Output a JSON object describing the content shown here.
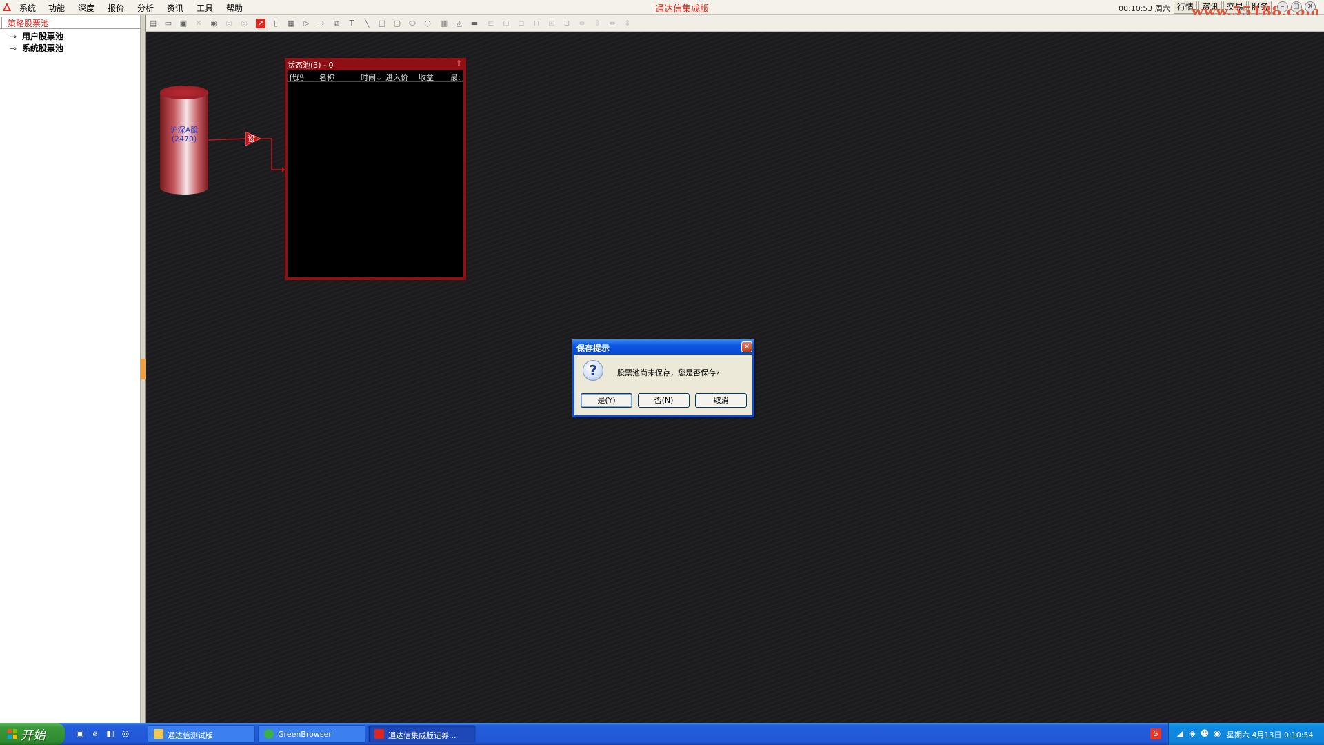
{
  "menubar": {
    "items": [
      "系统",
      "功能",
      "深度",
      "报价",
      "分析",
      "资讯",
      "工具",
      "帮助"
    ],
    "app_title": "通达信集成版",
    "clock": "00:10:53 周六",
    "right_buttons": [
      "行情",
      "资讯",
      "交易",
      "服务"
    ],
    "watermark": "www.55188.com"
  },
  "left_panel": {
    "tab": "策略股票池",
    "tree": [
      "用户股票池",
      "系统股票池"
    ]
  },
  "canvas": {
    "source_node": {
      "label": "沪深A股",
      "count": "(2470)"
    },
    "set_node": "设",
    "pool": {
      "title": "状态池(3) - 0",
      "columns": [
        "代码",
        "名称",
        "时间↓",
        "进入价",
        "收益",
        "最:"
      ]
    }
  },
  "dialog": {
    "title": "保存提示",
    "message": "股票池尚未保存，您是否保存?",
    "buttons": [
      "是(Y)",
      "否(N)",
      "取消"
    ]
  },
  "taskbar": {
    "start": "开始",
    "tasks": [
      "通达信测试版",
      "GreenBrowser",
      "通达信集成版证券..."
    ],
    "tray_time": "星期六 4月13日 0:10:54"
  },
  "colors": {
    "accent": "#e0241a",
    "pool_border": "#8e0f14",
    "canvas_bg": "#1c1c1e",
    "xp_blue": "#245edb"
  }
}
